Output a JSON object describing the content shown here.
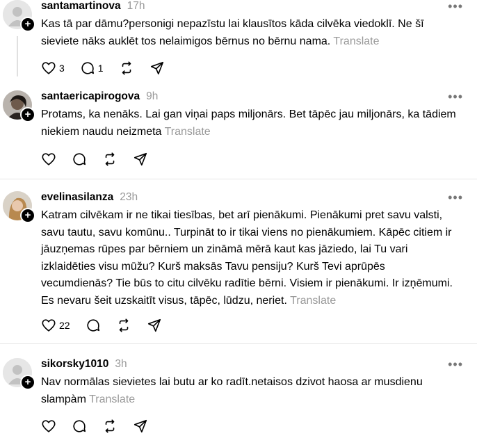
{
  "posts": [
    {
      "username": "santamartinova",
      "time": "17h",
      "text": "Kas tā par dāmu?personigi nepazīstu lai klausītos kāda cilvēka viedoklī. Ne šī sieviete nāks auklēt tos nelaimigos bērnus no bērnu nama.",
      "translate": "Translate",
      "likes": "3",
      "replies": "1",
      "avatar": "default-avatar"
    },
    {
      "username": "santaericapirogova",
      "time": "9h",
      "text": "Protams, ka nenāks. Lai gan viņai paps miljonārs. Bet tāpēc jau miljonārs, ka tādiem niekiem naudu neizmeta",
      "translate": "Translate",
      "likes": "",
      "replies": "",
      "avatar": "photo-avatar"
    },
    {
      "username": "evelinasilanza",
      "time": "23h",
      "text": "Katram cilvēkam ir ne tikai tiesības, bet arī pienākumi. Pienākumi pret savu valsti, savu tautu, savu komūnu.. Turpināt to ir tikai viens no pienākumiem. Kāpēc citiem ir jāuzņemas rūpes par bērniem un zināmā mērā kaut kas jāziedo, lai Tu vari izklaidēties visu mūžu? Kurš maksās Tavu pensiju? Kurš Tevi aprūpēs vecumdienās? Tie būs to citu cilvēku radītie bērni. Visiem ir pienākumi. Ir izņēmumi. Es nevaru šeit uzskaitīt visus, tāpēc, lūdzu, neriet.",
      "translate": "Translate",
      "likes": "22",
      "replies": "",
      "avatar": "photo-avatar"
    },
    {
      "username": "sikorsky1010",
      "time": "3h",
      "text": "Nav normālas sievietes lai butu ar ko radīt.netaisos dzivot haosa ar musdienu slampàm",
      "translate": "Translate",
      "likes": "",
      "replies": "",
      "avatar": "default-avatar"
    }
  ],
  "icons": {
    "more": "more-dots-icon",
    "like": "heart-icon",
    "reply": "comment-icon",
    "repost": "repost-icon",
    "share": "share-icon",
    "follow": "plus-icon"
  },
  "colors": {
    "muted": "#999999",
    "divider": "#e5e5e5",
    "text": "#000000"
  }
}
